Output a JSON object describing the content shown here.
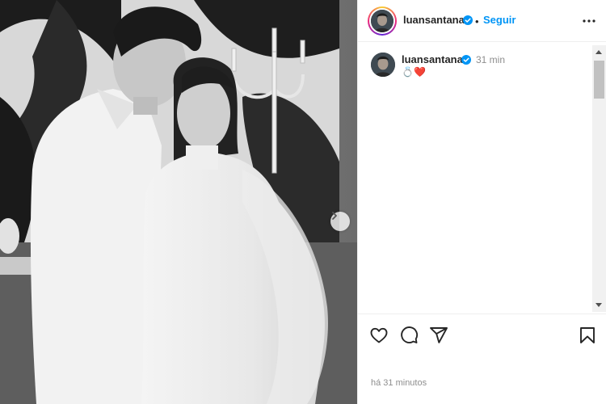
{
  "post": {
    "username": "luansantana",
    "separator": "•",
    "follow_label": "Seguir",
    "caption_time": "31 min",
    "caption_emojis": "💍❤️",
    "posted_ago": "há 31 minutos"
  },
  "icons": {
    "verified": "verified-badge-icon",
    "more": "more-options-icon",
    "like": "heart-icon",
    "comment": "comment-bubble-icon",
    "share": "paper-plane-icon",
    "save": "bookmark-icon",
    "carousel_next": "chevron-right-icon"
  },
  "colors": {
    "accent": "#0095f6",
    "verified": "#0095f6",
    "muted_text": "#8e8e8e",
    "text": "#262626"
  }
}
